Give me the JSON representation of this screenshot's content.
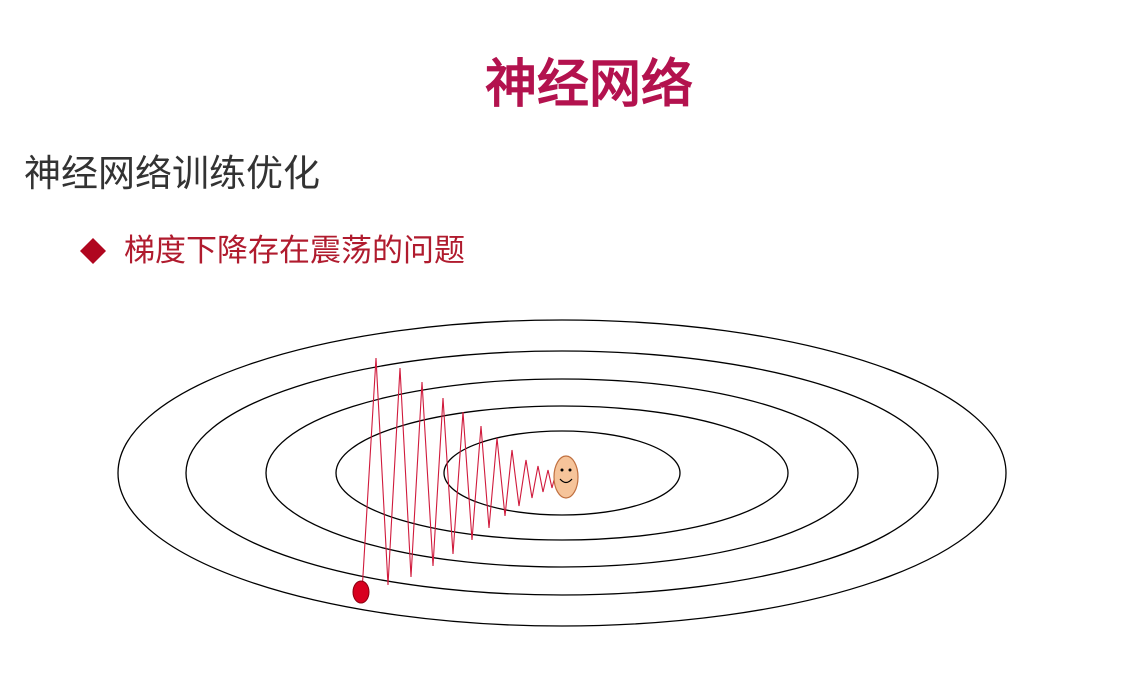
{
  "slide": {
    "title": "神经网络",
    "heading": "神经网络训练优化",
    "bullet": {
      "icon": "diamond-bullet-icon",
      "text": "梯度下降存在震荡的问题"
    }
  },
  "diagram": {
    "description_type": "contour-plot-with-oscillating-gradient-descent-path",
    "contour_count": 5,
    "contour_color": "#000000",
    "path_color": "#d01a3c",
    "start_point_color": "#d8001f",
    "goal_face_color": "#f6c49a",
    "start_icon": "start-point-icon",
    "goal_icon": "smiley-face-icon"
  }
}
